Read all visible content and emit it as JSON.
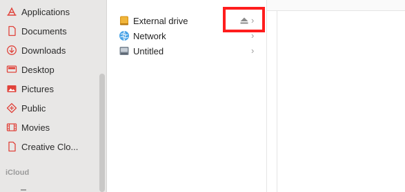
{
  "sidebar": {
    "items": [
      {
        "label": "Applications",
        "icon": "applications-icon"
      },
      {
        "label": "Documents",
        "icon": "document-icon"
      },
      {
        "label": "Downloads",
        "icon": "download-icon"
      },
      {
        "label": "Desktop",
        "icon": "desktop-icon"
      },
      {
        "label": "Pictures",
        "icon": "pictures-icon"
      },
      {
        "label": "Public",
        "icon": "public-icon"
      },
      {
        "label": "Movies",
        "icon": "movies-icon"
      },
      {
        "label": "Creative Clo...",
        "icon": "document-icon"
      }
    ],
    "icloud_header": "iCloud",
    "accent_color": "#e0423a"
  },
  "column": {
    "items": [
      {
        "label": "External drive",
        "icon": "external-drive-icon"
      },
      {
        "label": "Network",
        "icon": "network-icon"
      },
      {
        "label": "Untitled",
        "icon": "disk-icon"
      }
    ],
    "chevron": "›"
  }
}
